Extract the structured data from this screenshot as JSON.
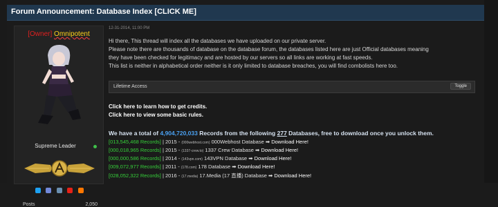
{
  "header": {
    "title": "Forum Announcement: Database Index [CLICK ME]"
  },
  "user": {
    "tag": "[Owner]",
    "name": "Omnipotent",
    "role": "Supreme Leader",
    "stats": {
      "label": "Posts",
      "value": "2,050"
    },
    "social_icons": [
      "twitter-icon",
      "discord-icon",
      "steam-icon",
      "youtube-icon",
      "soundcloud-icon"
    ]
  },
  "post": {
    "date": "12-31-2014, 11:00 PM",
    "intro": [
      "Hi there, This thread will index all the databases we have uploaded on our private server.",
      "Please note there are thousands of database on the database forum, the databases listed here are just Official databases meaning",
      "they have been checked for legitimacy and are hosted by our servers so all links are working at fast speeds.",
      "This list is neither in alphabetical order neither is it only limited to database breaches, you will find combolists here too."
    ],
    "spoiler": {
      "title": "Lifetime Access",
      "button": "Toggle"
    },
    "links": [
      "Click here to learn how to get credits.",
      "Click here to view some basic rules."
    ],
    "summary": {
      "prefix": "We have a total of ",
      "total": "4,904,720,033",
      "middle": " Records from the following ",
      "count": "277",
      "suffix": " Databases, free to download once you unlock them."
    },
    "records": [
      {
        "count": "[013,545,468 Records]",
        "year": " | 2015 - ",
        "source": "(000webhost.com)",
        "name": " 000Webhost Database ➡ ",
        "download": "Download Here!"
      },
      {
        "count": "[000,018,965 Records]",
        "year": " | 2015 - ",
        "source": "(1337-crew.to)",
        "name": " 1337 Crew Database ➡ ",
        "download": "Download Here!"
      },
      {
        "count": "[000,000,586 Records]",
        "year": " | 2014 - ",
        "source": "(143vpn.com)",
        "name": " 143VPN Database ➡ ",
        "download": "Download Here!"
      },
      {
        "count": "[009,072,977 Records]",
        "year": " | 2011 - ",
        "source": "(178.com)",
        "name": " 178 Database ➡ ",
        "download": "Download Here!"
      },
      {
        "count": "[028,052,322 Records]",
        "year": " | 2016 - ",
        "source": "(17.media)",
        "name": " 17.Media (17 直播) Database ➡ ",
        "download": "Download Here!"
      }
    ]
  }
}
